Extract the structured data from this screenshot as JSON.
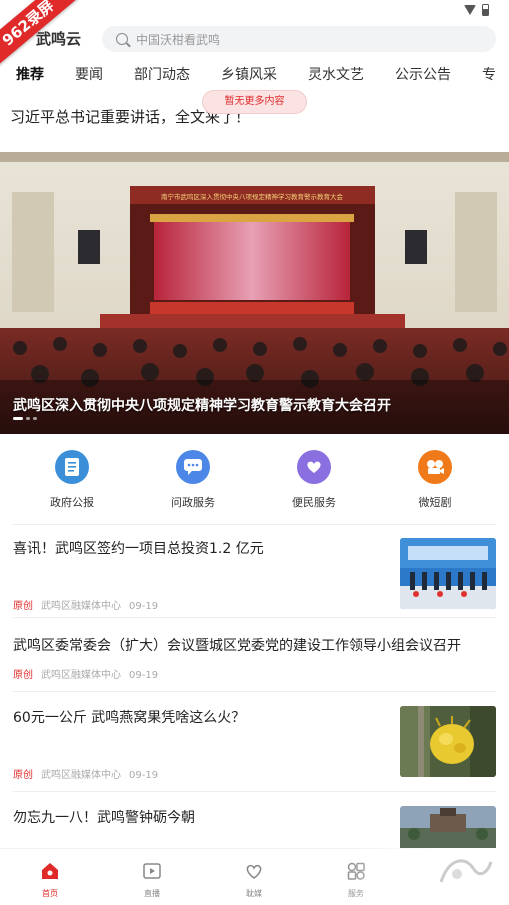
{
  "watermark": {
    "ribbon_text": "962录屏"
  },
  "header": {
    "app_name": "武鸣云",
    "search_placeholder": "中国沃柑看武鸣"
  },
  "tabs": [
    {
      "label": "推荐",
      "active": true
    },
    {
      "label": "要闻"
    },
    {
      "label": "部门动态"
    },
    {
      "label": "乡镇风采"
    },
    {
      "label": "灵水文艺"
    },
    {
      "label": "公示公告"
    },
    {
      "label": "专"
    }
  ],
  "toast": "暂无更多内容",
  "headline_strip": "习近平总书记重要讲话，全文来了！",
  "banner": {
    "caption": "武鸣区深入贯彻中央八项规定精神学习教育警示教育大会召开",
    "stage_text": "南宁市武鸣区深入贯彻中央八项规定精神学习教育警示教育大会"
  },
  "services": [
    {
      "label": "政府公报",
      "icon": "document-icon",
      "color": "#3b8fd9"
    },
    {
      "label": "问政服务",
      "icon": "chat-icon",
      "color": "#4c86e6"
    },
    {
      "label": "便民服务",
      "icon": "heart-hand-icon",
      "color": "#8a6fe0"
    },
    {
      "label": "微短剧",
      "icon": "film-reel-icon",
      "color": "#f07a1a"
    }
  ],
  "news": [
    {
      "title": "喜讯！武鸣区签约一项目总投资1.2 亿元",
      "origin": "原创",
      "source": "武鸣区融媒体中心",
      "date": "09-19"
    },
    {
      "title": "武鸣区委常委会（扩大）会议暨城区党委党的建设工作领导小组会议召开",
      "origin": "原创",
      "source": "武鸣区融媒体中心",
      "date": "09-19"
    },
    {
      "title": "60元一公斤 武鸣燕窝果凭啥这么火？",
      "origin": "原创",
      "source": "武鸣区融媒体中心",
      "date": "09-19"
    },
    {
      "title": "勿忘九一八！武鸣警钟砺今朝"
    }
  ],
  "bottom_nav": [
    {
      "label": "首页",
      "icon": "home-icon",
      "active": true
    },
    {
      "label": "直播",
      "icon": "play-icon"
    },
    {
      "label": "耽媒",
      "icon": "heart-icon"
    },
    {
      "label": "服务",
      "icon": "grid-icon"
    }
  ]
}
